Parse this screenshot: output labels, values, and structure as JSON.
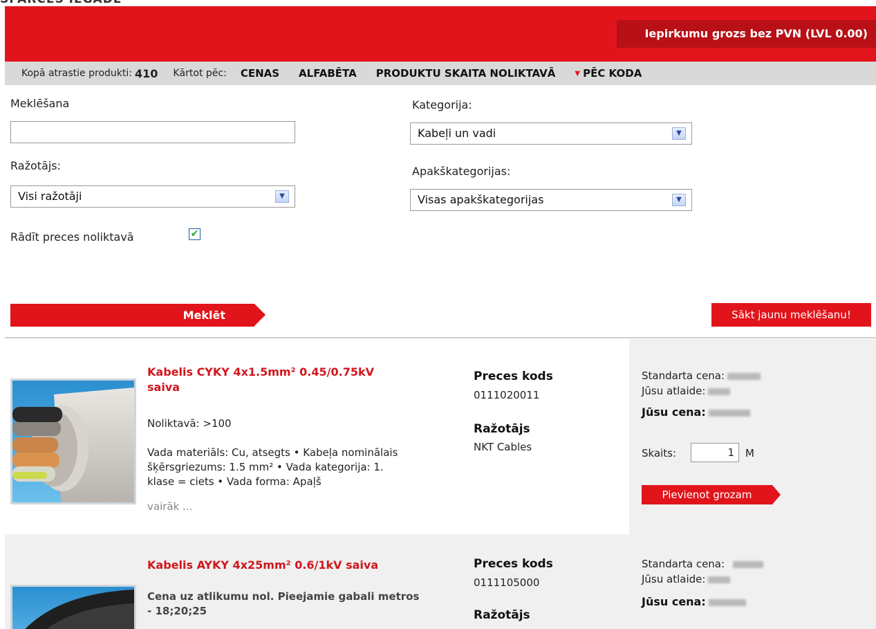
{
  "header": {
    "partial_title": "SPARCES IEGADE",
    "cart_label": "Iepirkumu grozs bez PVN (LVL 0.00)"
  },
  "sortbar": {
    "total_label": "Kopā atrastie produkti:",
    "total_count": "410",
    "sort_label": "Kārtot pēc:",
    "sort_options": [
      "CENAS",
      "ALFABĒTA",
      "PRODUKTU SKAITA NOLIKTAVĀ",
      "PĒC KODA"
    ],
    "active_sort": "PĒC KODA"
  },
  "filters": {
    "search_label": "Meklēšana",
    "search_value": "",
    "manufacturer_label": "Ražotājs:",
    "manufacturer_value": "Visi ražotāji",
    "category_label": "Kategorija:",
    "category_value": "Kabeļi un vadi",
    "subcategory_label": "Apakškategorijas:",
    "subcategory_value": "Visas apakškategorijas",
    "instock_label": "Rādīt preces noliktavā",
    "instock_checked": true,
    "search_button": "Meklēt",
    "reset_button": "Sākt jaunu meklēšanu!"
  },
  "products": [
    {
      "title_line1": "Kabelis CYKY 4x1.5mm² 0.45/0.75kV",
      "title_line2": "saiva",
      "stock": "Noliktavā: >100",
      "desc_line1": "Vada materiāls: Cu, atsegts • Kabeļa nominālais",
      "desc_line2": "šķērsgriezums: 1.5 mm² • Vada kategorija: 1.",
      "desc_line3": "klase = ciets • Vada forma: Apaļš",
      "more": "vairāk ...",
      "code_label": "Preces kods",
      "code": "0111020011",
      "manufacturer_label": "Ražotājs",
      "manufacturer": "NKT Cables",
      "std_price_label": "Standarta cena:",
      "discount_label": "Jūsu atlaide:",
      "your_price_label": "Jūsu cena:",
      "qty_label": "Skaits:",
      "qty": "1",
      "unit": "M",
      "add_button": "Pievienot grozam"
    },
    {
      "title_line1": "Kabelis AYKY 4x25mm² 0.6/1kV saiva",
      "note_line1": "Cena uz atlikumu nol. Pieejamie gabali metros",
      "note_line2": "- 18;20;25",
      "code_label": "Preces kods",
      "code": "0111105000",
      "manufacturer_label": "Ražotājs",
      "std_price_label": "Standarta cena:",
      "discount_label": "Jūsu atlaide:",
      "your_price_label": "Jūsu cena:"
    }
  ],
  "colors": {
    "brand_red": "#e2141b",
    "sortbar_gray": "#d9d9d9",
    "price_panel": "#f0f0f0"
  }
}
